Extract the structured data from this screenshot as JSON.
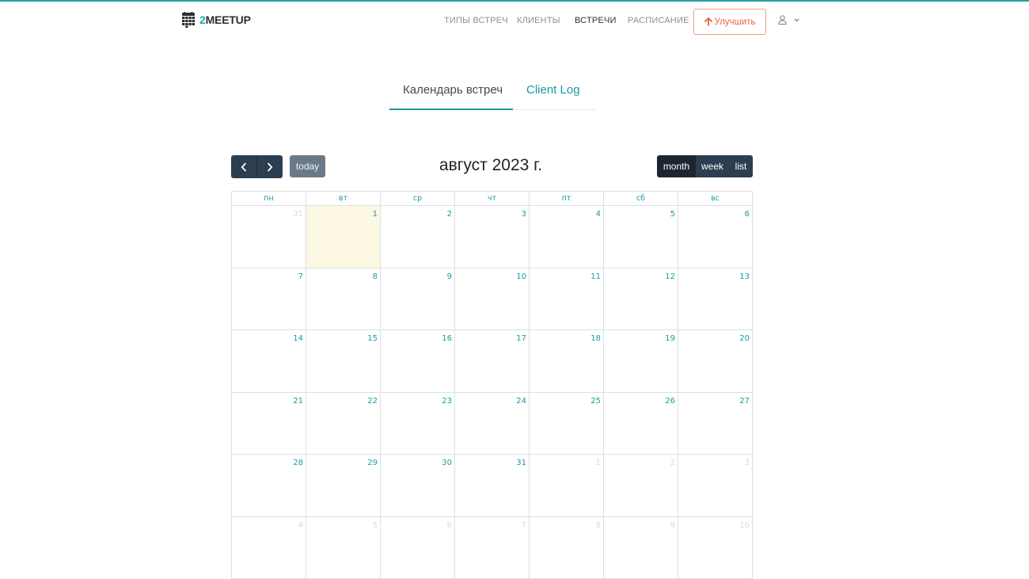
{
  "brand": {
    "name_prefix": "2",
    "name_rest": "MEETUP",
    "logo_icon": "calendar-grid-icon"
  },
  "nav": {
    "items": [
      {
        "label": "ТИПЫ ВСТРЕЧ",
        "active": false
      },
      {
        "label": "КЛИЕНТЫ",
        "active": false
      },
      {
        "label": "ВСТРЕЧИ",
        "active": true
      },
      {
        "label": "РАСПИСАНИЕ",
        "active": false
      }
    ],
    "upgrade_label": "Улучшить",
    "upgrade_icon": "arrow-up-icon",
    "user_icon": "user-icon",
    "chevron_icon": "chevron-down-icon"
  },
  "tabs": [
    {
      "label": "Календарь встреч",
      "active": true
    },
    {
      "label": "Client Log",
      "active": false
    }
  ],
  "toolbar": {
    "prev_icon": "chevron-left-icon",
    "next_icon": "chevron-right-icon",
    "today_label": "today",
    "title": "август 2023 г.",
    "views": [
      {
        "label": "month",
        "active": true
      },
      {
        "label": "week",
        "active": false
      },
      {
        "label": "list",
        "active": false
      }
    ]
  },
  "calendar": {
    "weekdays": [
      "пн",
      "вт",
      "ср",
      "чт",
      "пт",
      "сб",
      "вс"
    ],
    "today": "1",
    "weeks": [
      [
        {
          "day": "31",
          "other": true
        },
        {
          "day": "1",
          "other": false,
          "today": true
        },
        {
          "day": "2",
          "other": false
        },
        {
          "day": "3",
          "other": false
        },
        {
          "day": "4",
          "other": false
        },
        {
          "day": "5",
          "other": false
        },
        {
          "day": "6",
          "other": false
        }
      ],
      [
        {
          "day": "7",
          "other": false
        },
        {
          "day": "8",
          "other": false
        },
        {
          "day": "9",
          "other": false
        },
        {
          "day": "10",
          "other": false
        },
        {
          "day": "11",
          "other": false
        },
        {
          "day": "12",
          "other": false
        },
        {
          "day": "13",
          "other": false
        }
      ],
      [
        {
          "day": "14",
          "other": false
        },
        {
          "day": "15",
          "other": false
        },
        {
          "day": "16",
          "other": false
        },
        {
          "day": "17",
          "other": false
        },
        {
          "day": "18",
          "other": false
        },
        {
          "day": "19",
          "other": false
        },
        {
          "day": "20",
          "other": false
        }
      ],
      [
        {
          "day": "21",
          "other": false
        },
        {
          "day": "22",
          "other": false
        },
        {
          "day": "23",
          "other": false
        },
        {
          "day": "24",
          "other": false
        },
        {
          "day": "25",
          "other": false
        },
        {
          "day": "26",
          "other": false
        },
        {
          "day": "27",
          "other": false
        }
      ],
      [
        {
          "day": "28",
          "other": false
        },
        {
          "day": "29",
          "other": false
        },
        {
          "day": "30",
          "other": false
        },
        {
          "day": "31",
          "other": false
        },
        {
          "day": "1",
          "other": true
        },
        {
          "day": "2",
          "other": true
        },
        {
          "day": "3",
          "other": true
        }
      ],
      [
        {
          "day": "4",
          "other": true
        },
        {
          "day": "5",
          "other": true
        },
        {
          "day": "6",
          "other": true
        },
        {
          "day": "7",
          "other": true
        },
        {
          "day": "8",
          "other": true
        },
        {
          "day": "9",
          "other": true
        },
        {
          "day": "10",
          "other": true
        }
      ]
    ]
  },
  "colors": {
    "accent": "#1a9aa3",
    "upgrade": "#e0653e",
    "dark_button": "#2c3e50",
    "today_bg": "#fcf8e3"
  }
}
